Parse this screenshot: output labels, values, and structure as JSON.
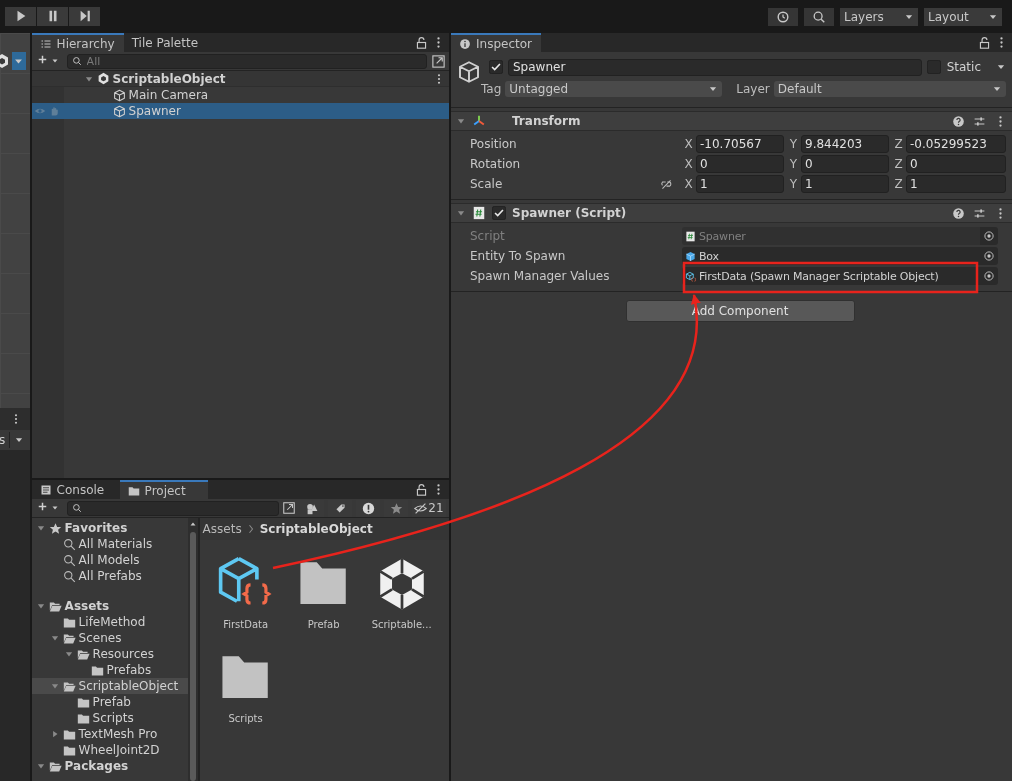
{
  "toolbar": {
    "dropdowns": [
      "Layers",
      "Layout"
    ]
  },
  "scene_strip": {
    "label": "s"
  },
  "hierarchy": {
    "tabs": [
      {
        "label": "Hierarchy",
        "selected": true
      },
      {
        "label": "Tile Palette",
        "selected": false
      }
    ],
    "search": {
      "placeholder": "All"
    },
    "items": [
      {
        "label": "ScriptableObject",
        "kind": "scene",
        "expanded": true,
        "selected": false,
        "children": [
          {
            "label": "Main Camera",
            "kind": "object",
            "selected": false
          },
          {
            "label": "Spawner",
            "kind": "object",
            "selected": true
          }
        ]
      }
    ]
  },
  "inspector": {
    "tab": {
      "label": "Inspector",
      "selected": true
    },
    "object": {
      "name": "Spawner",
      "active": true,
      "static": false,
      "static_label": "Static",
      "tag_label": "Tag",
      "tag": "Untagged",
      "layer_label": "Layer",
      "layer": "Default"
    },
    "transform": {
      "title": "Transform",
      "expanded": true,
      "rows": [
        {
          "label": "Position",
          "values": [
            {
              "axis": "X",
              "value": "-10.70567"
            },
            {
              "axis": "Y",
              "value": "9.844203"
            },
            {
              "axis": "Z",
              "value": "-0.05299523"
            }
          ]
        },
        {
          "label": "Rotation",
          "values": [
            {
              "axis": "X",
              "value": "0"
            },
            {
              "axis": "Y",
              "value": "0"
            },
            {
              "axis": "Z",
              "value": "0"
            }
          ]
        },
        {
          "label": "Scale",
          "linked": false,
          "values": [
            {
              "axis": "X",
              "value": "1"
            },
            {
              "axis": "Y",
              "value": "1"
            },
            {
              "axis": "Z",
              "value": "1"
            }
          ]
        }
      ]
    },
    "script": {
      "title": "Spawner (Script)",
      "expanded": true,
      "enabled": true,
      "fields": [
        {
          "label": "Script",
          "value": "Spawner",
          "kind": "script",
          "disabled": true
        },
        {
          "label": "Entity To Spawn",
          "value": "Box",
          "kind": "prefab",
          "disabled": false
        },
        {
          "label": "Spawn Manager Values",
          "value": "FirstData (Spawn Manager Scriptable Object)",
          "kind": "asset",
          "disabled": false
        }
      ]
    },
    "add_component": "Add Component"
  },
  "project": {
    "tabs": [
      {
        "label": "Console",
        "kind": "console",
        "selected": false
      },
      {
        "label": "Project",
        "kind": "folder",
        "selected": true
      }
    ],
    "hidden_count": "21",
    "tree": [
      {
        "label": "Favorites",
        "kind": "favorites",
        "expanded": true,
        "selected": false,
        "children": [
          {
            "label": "All Materials",
            "kind": "search",
            "selected": false
          },
          {
            "label": "All Models",
            "kind": "search",
            "selected": false
          },
          {
            "label": "All Prefabs",
            "kind": "search",
            "selected": false
          }
        ]
      },
      {
        "label": "Assets",
        "kind": "root",
        "expanded": true,
        "selected": false,
        "children": [
          {
            "label": "LifeMethod",
            "kind": "folder",
            "selected": false
          },
          {
            "label": "Scenes",
            "kind": "folder",
            "expanded": true,
            "selected": false,
            "children": [
              {
                "label": "Resources",
                "kind": "folder",
                "expanded": true,
                "selected": false,
                "children": [
                  {
                    "label": "Prefabs",
                    "kind": "folder",
                    "selected": false
                  }
                ]
              }
            ]
          },
          {
            "label": "ScriptableObject",
            "kind": "folder",
            "expanded": true,
            "selected": true,
            "children": [
              {
                "label": "Prefab",
                "kind": "folder",
                "selected": false
              },
              {
                "label": "Scripts",
                "kind": "folder",
                "selected": false
              }
            ]
          },
          {
            "label": "TextMesh Pro",
            "kind": "folder",
            "expanded": false,
            "selected": false
          },
          {
            "label": "WheelJoint2D",
            "kind": "folder",
            "selected": false
          }
        ]
      },
      {
        "label": "Packages",
        "kind": "root",
        "expanded": true,
        "selected": false
      }
    ],
    "breadcrumb": [
      "Assets",
      "ScriptableObject"
    ],
    "assets": [
      {
        "name": "FirstData",
        "kind": "scriptable"
      },
      {
        "name": "Prefab",
        "kind": "folder"
      },
      {
        "name": "Scriptable...",
        "kind": "unity"
      },
      {
        "name": "Scripts",
        "kind": "folder"
      }
    ]
  },
  "annotation": {
    "highlight": true,
    "arrow": true
  }
}
